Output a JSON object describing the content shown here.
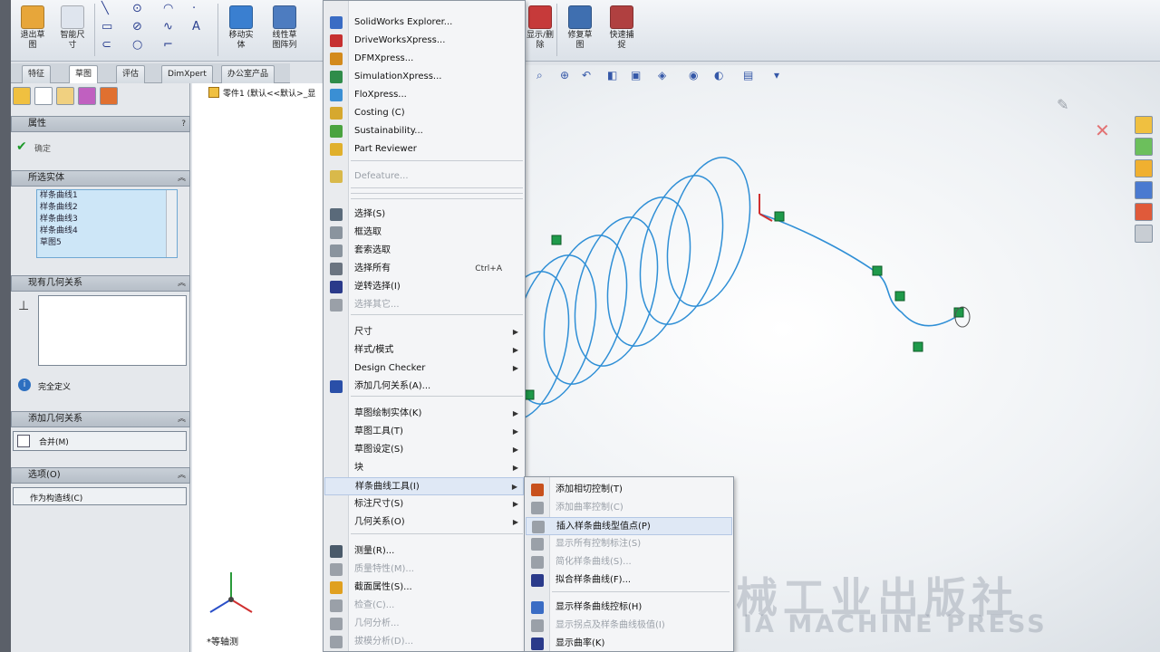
{
  "ribbon": {
    "buttons": [
      {
        "id": "exit-sketch",
        "label": "退出草\n图",
        "color": "#e7a63a"
      },
      {
        "id": "smart-dim",
        "label": "智能尺\n寸",
        "color": "#2b4fa8"
      },
      {
        "id": "move",
        "label": "移动实\n体",
        "color": "#3a7fd0"
      },
      {
        "id": "array",
        "label": "线性草\n图阵列",
        "color": "#4d7cc0"
      },
      {
        "id": "display",
        "label": "显示/删\n除",
        "color": "#c63a3a"
      },
      {
        "id": "repair",
        "label": "修复草\n图",
        "color": "#3f6fb0"
      },
      {
        "id": "quick",
        "label": "快速捕\n捉",
        "color": "#b04040"
      }
    ]
  },
  "tabs": [
    "特征",
    "草图",
    "评估",
    "DimXpert",
    "办公室产品"
  ],
  "property_manager": {
    "title": "属性",
    "ok_label": "确定",
    "selected_entities_header": "所选实体",
    "selected_items": [
      "样条曲线1",
      "样条曲线2",
      "样条曲线3",
      "样条曲线4",
      "草图5"
    ],
    "existing_relations_header": "现有几何关系",
    "info_text": "完全定义",
    "add_relations_header": "添加几何关系",
    "merge_label": "合并(M)",
    "options_header": "选项(O)",
    "construction_label": "作为构造线(C)"
  },
  "tree": {
    "root_label": "零件1 (默认<<默认>_显"
  },
  "context_menu": {
    "items": [
      {
        "label": "SolidWorks Explorer...",
        "icon_color": "#3a6cc4",
        "disabled": false
      },
      {
        "label": "DriveWorksXpress...",
        "icon_color": "#c63030",
        "disabled": false
      },
      {
        "label": "DFMXpress...",
        "icon_color": "#d38a1c",
        "disabled": false
      },
      {
        "label": "SimulationXpress...",
        "icon_color": "#2f8c4a",
        "disabled": false
      },
      {
        "label": "FloXpress...",
        "icon_color": "#3a8fd4",
        "disabled": false
      },
      {
        "label": "Costing (C)",
        "icon_color": "#d6a82e",
        "disabled": false
      },
      {
        "label": "Sustainability...",
        "icon_color": "#4aa33f",
        "disabled": false
      },
      {
        "label": "Part Reviewer",
        "icon_color": "#e0b02c",
        "disabled": false
      },
      {
        "label": "Defeature...",
        "icon_color": "#d9b94a",
        "disabled": true
      },
      {
        "label": "选择(S)",
        "icon_color": "#5a6a7a",
        "disabled": false
      },
      {
        "label": "框选取",
        "icon_color": "#8a949e",
        "disabled": false
      },
      {
        "label": "套索选取",
        "icon_color": "#8a949e",
        "disabled": false
      },
      {
        "label": "选择所有",
        "icon_color": "#6a7480",
        "disabled": false,
        "shortcut": "Ctrl+A"
      },
      {
        "label": "逆转选择(I)",
        "icon_color": "#2a3a8a",
        "disabled": false
      },
      {
        "label": "选择其它...",
        "icon_color": "#9aa0a8",
        "disabled": true
      },
      {
        "label": "尺寸",
        "submenu": true
      },
      {
        "label": "样式/模式",
        "submenu": true
      },
      {
        "label": "Design Checker",
        "submenu": true
      },
      {
        "label": "添加几何关系(A)...",
        "icon_color": "#2a4fa8",
        "disabled": false
      },
      {
        "label": "草图绘制实体(K)",
        "submenu": true
      },
      {
        "label": "草图工具(T)",
        "submenu": true
      },
      {
        "label": "草图设定(S)",
        "submenu": true
      },
      {
        "label": "块",
        "submenu": true
      },
      {
        "label": "样条曲线工具(I)",
        "submenu": true,
        "highlight": true
      },
      {
        "label": "标注尺寸(S)",
        "submenu": true
      },
      {
        "label": "几何关系(O)",
        "submenu": true
      },
      {
        "label": "测量(R)...",
        "icon_color": "#4a5a6a",
        "disabled": false
      },
      {
        "label": "质量特性(M)...",
        "icon_color": "#9aa0a8",
        "disabled": true
      },
      {
        "label": "截面属性(S)...",
        "icon_color": "#e0a020",
        "disabled": false
      },
      {
        "label": "检查(C)...",
        "icon_color": "#9aa0a8",
        "disabled": true
      },
      {
        "label": "几何分析...",
        "icon_color": "#9aa0a8",
        "disabled": true
      },
      {
        "label": "拔模分析(D)...",
        "icon_color": "#9aa0a8",
        "disabled": true
      }
    ]
  },
  "submenu": {
    "items": [
      {
        "label": "添加相切控制(T)",
        "icon_color": "#c8501c",
        "disabled": false
      },
      {
        "label": "添加曲率控制(C)",
        "icon_color": "#9aa0a8",
        "disabled": true
      },
      {
        "label": "插入样条曲线型值点(P)",
        "icon_color": "#9aa0a8",
        "disabled": false,
        "highlight": true
      },
      {
        "label": "显示所有控制标注(S)",
        "icon_color": "#9aa0a8",
        "disabled": true
      },
      {
        "label": "简化样条曲线(S)...",
        "icon_color": "#9aa0a8",
        "disabled": true
      },
      {
        "label": "拟合样条曲线(F)...",
        "icon_color": "#2a3a8a",
        "disabled": false
      },
      {
        "label": "显示样条曲线控标(H)",
        "icon_color": "#3a6cc4",
        "disabled": false
      },
      {
        "label": "显示拐点及样条曲线极值(I)",
        "icon_color": "#9aa0a8",
        "disabled": true
      },
      {
        "label": "显示曲率(K)",
        "icon_color": "#2a3a8a",
        "disabled": false
      }
    ]
  },
  "watermark": {
    "chinese": "械工业出版社",
    "english": "IA MACHINE PRESS"
  },
  "view_label": "*等轴测",
  "curve_color": "#2f8fd6",
  "handle_color": "#1f9a4a"
}
